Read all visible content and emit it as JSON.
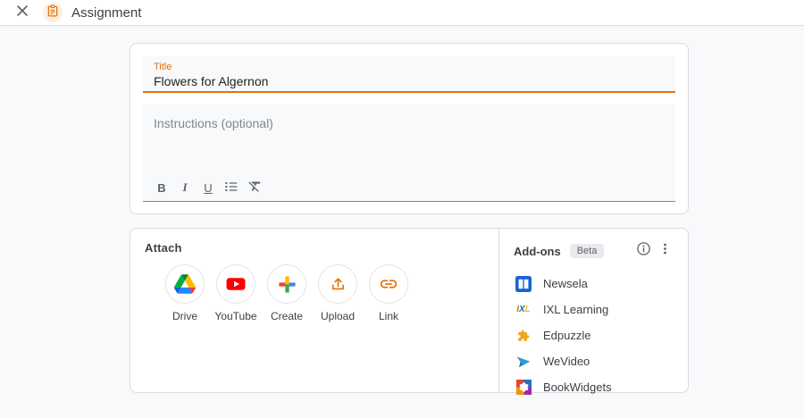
{
  "header": {
    "title": "Assignment",
    "close_icon": "close-x",
    "type_icon": "assignment-clipboard"
  },
  "form": {
    "title_field": {
      "label": "Title",
      "value": "Flowers for Algernon"
    },
    "instructions_field": {
      "placeholder": "Instructions (optional)"
    },
    "toolbar": {
      "bold": "B",
      "italic": "I",
      "underline": "U",
      "list_icon": "bulleted-list",
      "clear_icon": "clear-formatting"
    }
  },
  "attach": {
    "label": "Attach",
    "options": [
      {
        "label": "Drive",
        "icon": "google-drive"
      },
      {
        "label": "YouTube",
        "icon": "youtube"
      },
      {
        "label": "Create",
        "icon": "google-plus-create"
      },
      {
        "label": "Upload",
        "icon": "upload-arrow"
      },
      {
        "label": "Link",
        "icon": "chain-link"
      }
    ]
  },
  "addons": {
    "title": "Add-ons",
    "badge": "Beta",
    "info_icon": "info-circle",
    "menu_icon": "three-dot-menu",
    "items": [
      {
        "label": "Newsela",
        "icon": "newsela"
      },
      {
        "label": "IXL Learning",
        "icon": "ixl",
        "logo_i": "I",
        "logo_x": "X",
        "logo_l": "L"
      },
      {
        "label": "Edpuzzle",
        "icon": "edpuzzle-puzzle"
      },
      {
        "label": "WeVideo",
        "icon": "wevideo-plane"
      },
      {
        "label": "BookWidgets",
        "icon": "bookwidgets-grid"
      }
    ]
  },
  "colors": {
    "accent_orange": "#e8710a",
    "page_bg": "#f8f9fa",
    "card_border": "#dadce0",
    "text_primary": "#3c4043",
    "text_secondary": "#5f6368",
    "placeholder": "#80868b",
    "badge_bg": "#e8eaed",
    "drive_blue": "#2684fc",
    "drive_green": "#00ac47",
    "drive_yellow": "#ffba00",
    "youtube_red": "#ff0000",
    "google_red": "#ea4335",
    "google_blue": "#4285f4",
    "google_yellow": "#fbbc04",
    "google_green": "#34a853",
    "newsela_blue": "#1565d8",
    "wevideo_blue": "#2e9cd6"
  }
}
